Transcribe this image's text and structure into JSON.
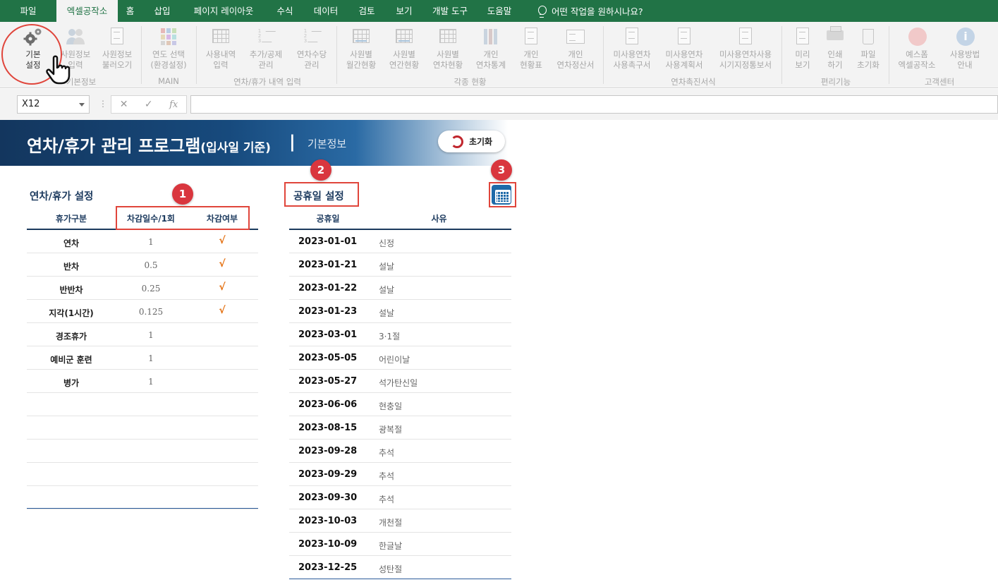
{
  "menu": {
    "items": [
      "파일",
      "엑셀공작소",
      "홈",
      "삽입",
      "페이지 레이아웃",
      "수식",
      "데이터",
      "검토",
      "보기",
      "개발 도구",
      "도움말"
    ],
    "active_index": 1,
    "tell_me": "어떤 작업을 원하시나요?"
  },
  "ribbon": {
    "buttons": [
      {
        "label": "기본\n설정",
        "icon": "gear-icon"
      },
      {
        "label": "사원정보\n입력",
        "icon": "users-icon"
      },
      {
        "label": "사원정보\n불러오기",
        "icon": "import-icon"
      },
      {
        "label": "연도 선택\n(환경설정)",
        "icon": "palette-icon"
      },
      {
        "label": "사용내역\n입력",
        "icon": "calendar-edit-icon"
      },
      {
        "label": "추가/공제\n관리",
        "icon": "list-edit-icon"
      },
      {
        "label": "연차수당\n관리",
        "icon": "list-edit-icon"
      },
      {
        "label": "사원별\n월간현황",
        "icon": "calendar-grid-icon"
      },
      {
        "label": "사원별\n연간현황",
        "icon": "calendar-grid-icon"
      },
      {
        "label": "사원별\n연차현황",
        "icon": "grid-plus-icon"
      },
      {
        "label": "개인\n연차통계",
        "icon": "bar-chart-icon"
      },
      {
        "label": "개인\n현황표",
        "icon": "checklist-icon"
      },
      {
        "label": "개인\n연차정산서",
        "icon": "id-card-icon"
      },
      {
        "label": "미사용연차\n사용촉구서",
        "icon": "clipboard-icon"
      },
      {
        "label": "미사용연차\n사용계획서",
        "icon": "clipboard-icon"
      },
      {
        "label": "미사용연차사용\n시기지정통보서",
        "icon": "clipboard-icon"
      },
      {
        "label": "미리\n보기",
        "icon": "preview-icon"
      },
      {
        "label": "인쇄\n하기",
        "icon": "printer-icon"
      },
      {
        "label": "파일\n초기화",
        "icon": "trash-icon"
      },
      {
        "label": "예스폼\n엑셀공작소",
        "icon": "yesform-icon"
      },
      {
        "label": "사용방법\n안내",
        "icon": "info-icon"
      }
    ],
    "groups": [
      "기본정보",
      "MAIN",
      "연차/휴가 내역 입력",
      "각종 현황",
      "연차촉진서식",
      "편리기능",
      "고객센터"
    ]
  },
  "formula_bar": {
    "name_box": "X12",
    "fx": "fx",
    "formula": ""
  },
  "banner": {
    "title": "연차/휴가 관리 프로그램",
    "title_sub": "(입사일 기준)",
    "pipe": "|",
    "section": "기본정보",
    "reset_label": "초기화"
  },
  "leave_settings": {
    "title": "연차/휴가 설정",
    "headers": [
      "휴가구분",
      "차감일수/1회",
      "차감여부"
    ],
    "rows": [
      {
        "type": "연차",
        "days": "1",
        "deduct": "√"
      },
      {
        "type": "반차",
        "days": "0.5",
        "deduct": "√"
      },
      {
        "type": "반반차",
        "days": "0.25",
        "deduct": "√"
      },
      {
        "type": "지각(1시간)",
        "days": "0.125",
        "deduct": "√"
      },
      {
        "type": "경조휴가",
        "days": "1",
        "deduct": ""
      },
      {
        "type": "예비군 훈련",
        "days": "1",
        "deduct": ""
      },
      {
        "type": "병가",
        "days": "1",
        "deduct": ""
      }
    ]
  },
  "holiday_settings": {
    "title": "공휴일 설정",
    "headers": [
      "공휴일",
      "사유"
    ],
    "rows": [
      {
        "date": "2023-01-01",
        "reason": "신정"
      },
      {
        "date": "2023-01-21",
        "reason": "설날"
      },
      {
        "date": "2023-01-22",
        "reason": "설날"
      },
      {
        "date": "2023-01-23",
        "reason": "설날"
      },
      {
        "date": "2023-03-01",
        "reason": "3·1절"
      },
      {
        "date": "2023-05-05",
        "reason": "어린이날"
      },
      {
        "date": "2023-05-27",
        "reason": "석가탄신일"
      },
      {
        "date": "2023-06-06",
        "reason": "현충일"
      },
      {
        "date": "2023-08-15",
        "reason": "광복절"
      },
      {
        "date": "2023-09-28",
        "reason": "추석"
      },
      {
        "date": "2023-09-29",
        "reason": "추석"
      },
      {
        "date": "2023-09-30",
        "reason": "추석"
      },
      {
        "date": "2023-10-03",
        "reason": "개천절"
      },
      {
        "date": "2023-10-09",
        "reason": "한글날"
      },
      {
        "date": "2023-12-25",
        "reason": "성탄절"
      }
    ]
  },
  "annotations": [
    "1",
    "2",
    "3"
  ],
  "colors": {
    "excel_green": "#217346",
    "banner_navy": "#13365e",
    "table_header": "#1c3a5e",
    "check_orange": "#e36c0a",
    "annotation_red": "#d9363e",
    "calendar_blue": "#1e6aa8"
  }
}
